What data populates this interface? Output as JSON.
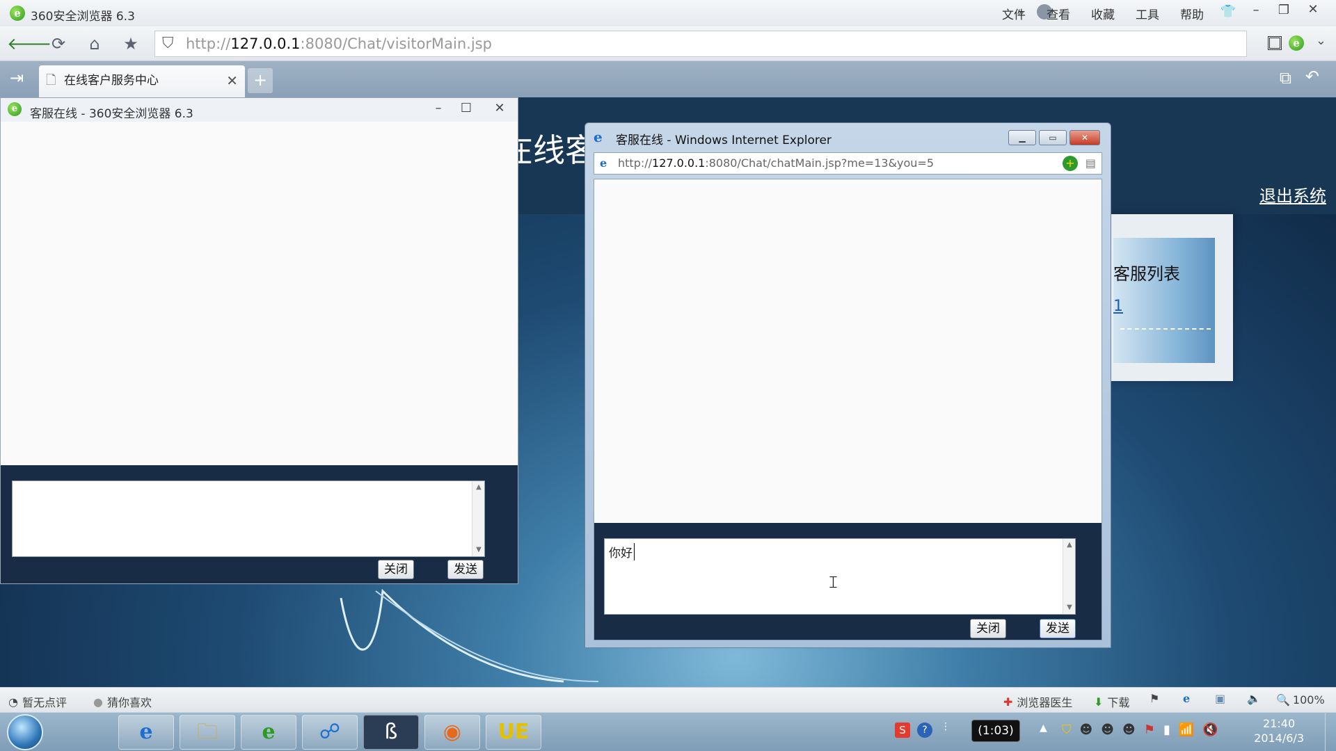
{
  "browser": {
    "app_title": "360安全浏览器 6.3",
    "menu": [
      "文件",
      "查看",
      "收藏",
      "工具",
      "帮助"
    ],
    "url_prefix": "http://",
    "url_host": "127.0.0.1",
    "url_rest": ":8080/Chat/visitorMain.jsp",
    "tab_title": "在线客户服务中心"
  },
  "page": {
    "title_fragment": "在线客",
    "logout": "退出系统",
    "cs_list_title": "客服列表",
    "cs_item": "1"
  },
  "popup360": {
    "title": "客服在线 - 360安全浏览器 6.3",
    "message_value": "",
    "close_label": "关闭",
    "send_label": "发送"
  },
  "popupIE": {
    "title": "客服在线 - Windows Internet Explorer",
    "url_prefix": "http://",
    "url_host": "127.0.0.1",
    "url_rest": ":8080/Chat/chatMain.jsp?me=13&you=5",
    "message_value": "你好",
    "close_label": "关闭",
    "send_label": "发送"
  },
  "statusbar": {
    "left_items": [
      "暂无点评",
      "猜你喜欢"
    ],
    "doctor": "浏览器医生",
    "download": "下载",
    "zoom": "100%"
  },
  "taskbar": {
    "timer": "(1:03)",
    "time": "21:40",
    "date": "2014/6/3"
  },
  "colors": {
    "accent_blue": "#1a5fb4",
    "page_dark": "#182d45",
    "ie_close_red": "#c63c25"
  }
}
